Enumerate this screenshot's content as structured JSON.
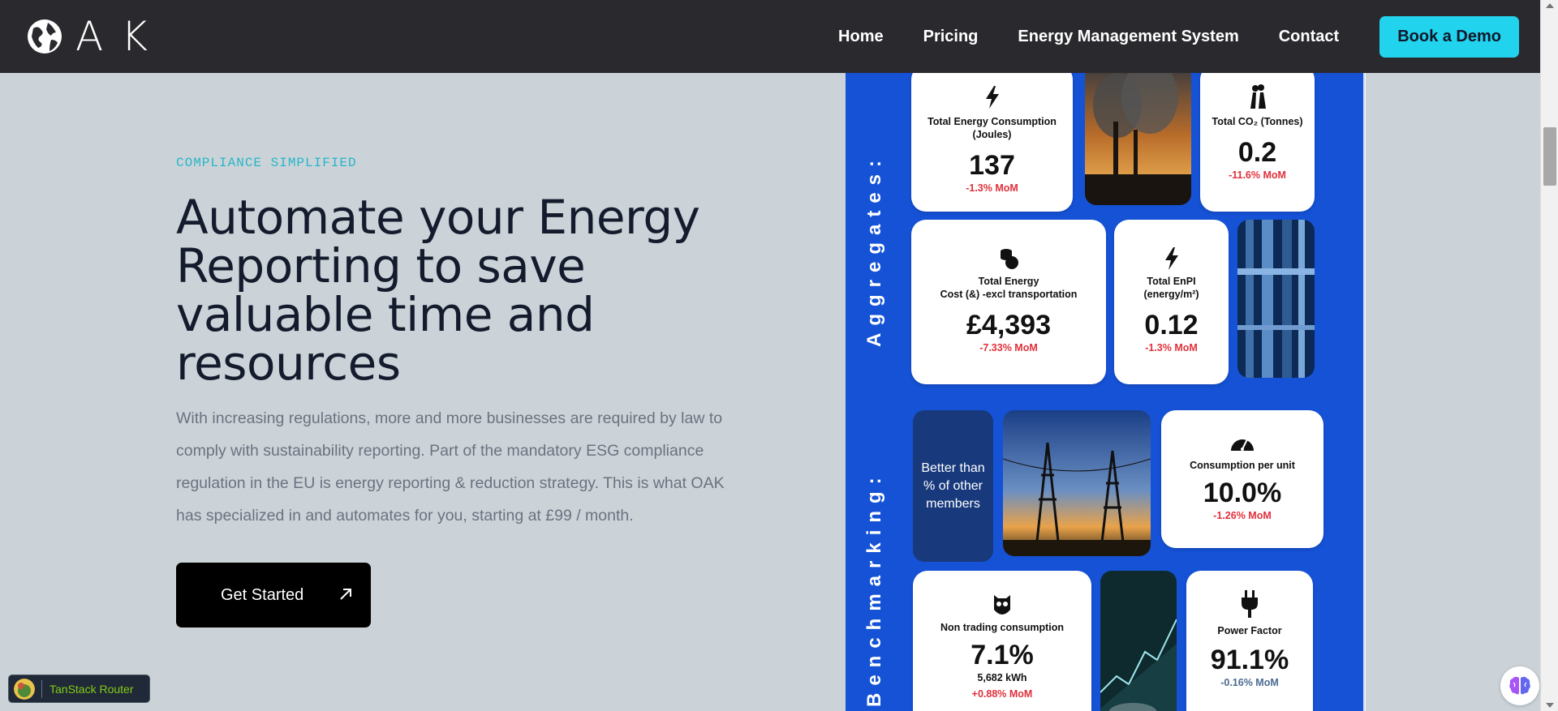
{
  "header": {
    "logo_text": "AK",
    "nav": [
      "Home",
      "Pricing",
      "Energy Management System",
      "Contact"
    ],
    "cta": "Book a Demo"
  },
  "hero": {
    "eyebrow": "COMPLIANCE SIMPLIFIED",
    "headline": "Automate your Energy Reporting to save valuable time and resources",
    "description": "With increasing regulations, more and more businesses are required by law to comply with sustainability reporting. Part of the mandatory ESG compliance regulation in the EU is energy reporting & reduction strategy. This is what OAK has specialized in and automates for you, starting at £99 / month.",
    "cta": "Get Started"
  },
  "infographic": {
    "aggregates_label": "Aggregates:",
    "benchmarking_label": "Benchmarking:",
    "cards": {
      "energy": {
        "label": "Total Energy Consumption (Joules)",
        "value": "137",
        "change": "-1.3% MoM"
      },
      "co2": {
        "label": "Total CO₂ (Tonnes)",
        "value": "0.2",
        "change": "-11.6% MoM"
      },
      "cost": {
        "label_line1": "Total Energy",
        "label_line2": "Cost (&) -excl transportation",
        "value": "£4,393",
        "change": "-7.33% MoM"
      },
      "enpi": {
        "label_line1": "Total EnPI",
        "label_line2": "(energy/m²)",
        "value": "0.12",
        "change": "-1.3% MoM"
      },
      "better": {
        "text": "Better than % of other members"
      },
      "per_unit": {
        "label": "Consumption per unit",
        "value": "10.0%",
        "change": "-1.26% MoM"
      },
      "non_trading": {
        "label": "Non trading consumption",
        "value": "7.1%",
        "sub": "5,682 kWh",
        "change": "+0.88% MoM"
      },
      "power_factor": {
        "label": "Power Factor",
        "value": "91.1%",
        "change": "-0.16% MoM"
      }
    }
  },
  "badges": {
    "tanstack": "TanStack Router"
  }
}
